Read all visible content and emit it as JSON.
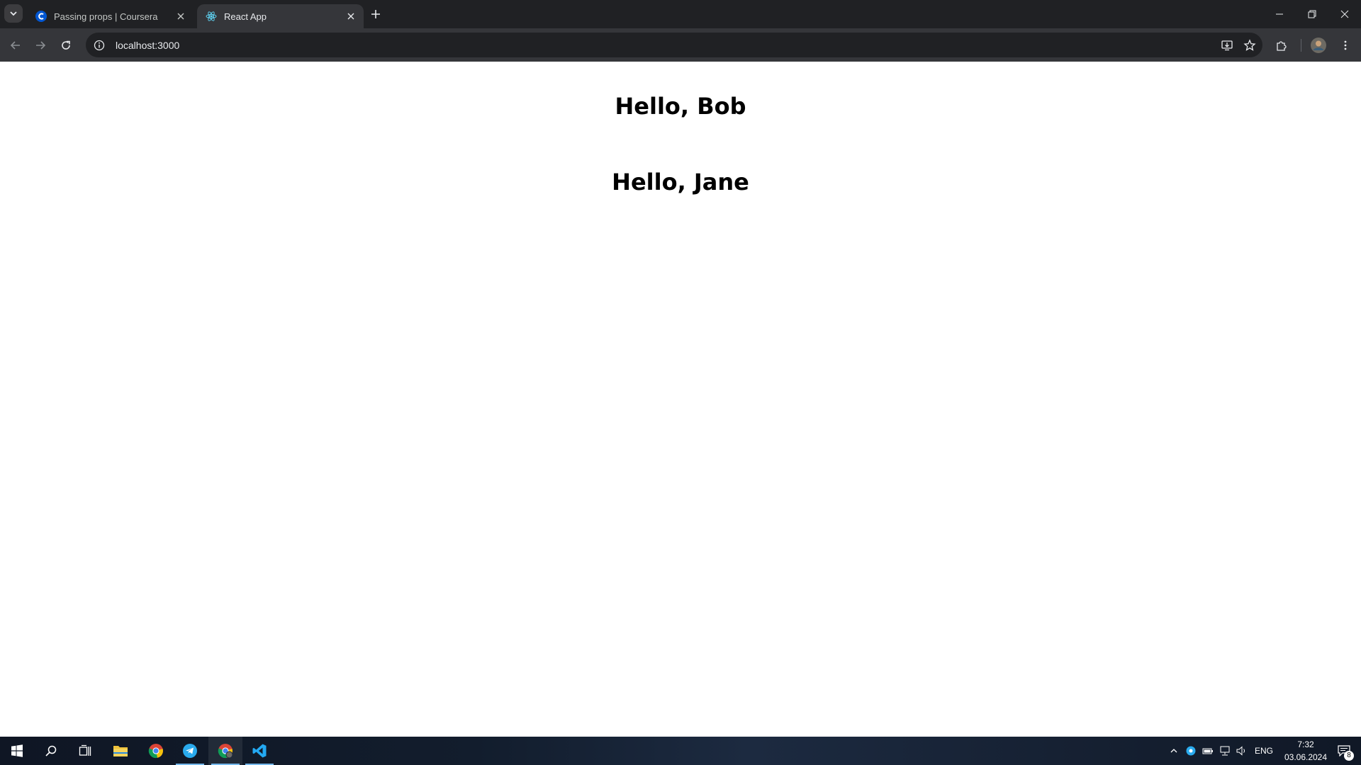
{
  "browser": {
    "tabs": [
      {
        "title": "Passing props | Coursera",
        "favicon": "coursera-favicon",
        "active": false
      },
      {
        "title": "React App",
        "favicon": "react-favicon",
        "active": true
      }
    ],
    "address_bar": {
      "url": "localhost:3000"
    },
    "icons": {
      "back": "back-arrow-icon",
      "forward": "forward-arrow-icon",
      "reload": "reload-icon",
      "site_info": "info-icon",
      "install": "install-app-icon",
      "bookmark": "star-icon",
      "extensions": "puzzle-icon",
      "profile": "avatar",
      "menu": "kebab-menu-icon"
    }
  },
  "page": {
    "greetings": [
      "Hello, Bob",
      "Hello, Jane"
    ]
  },
  "taskbar": {
    "apps": [
      "windows-start",
      "search",
      "task-view",
      "file-explorer",
      "chrome",
      "telegram",
      "chrome-profile",
      "vscode"
    ],
    "language": "ENG",
    "time": "7:32",
    "date": "03.06.2024",
    "notification_count": "8"
  },
  "colors": {
    "tabstrip": "#202124",
    "toolbar": "#35363a",
    "vscode_blue": "#23a9f2",
    "telegram_blue": "#2aabee"
  }
}
